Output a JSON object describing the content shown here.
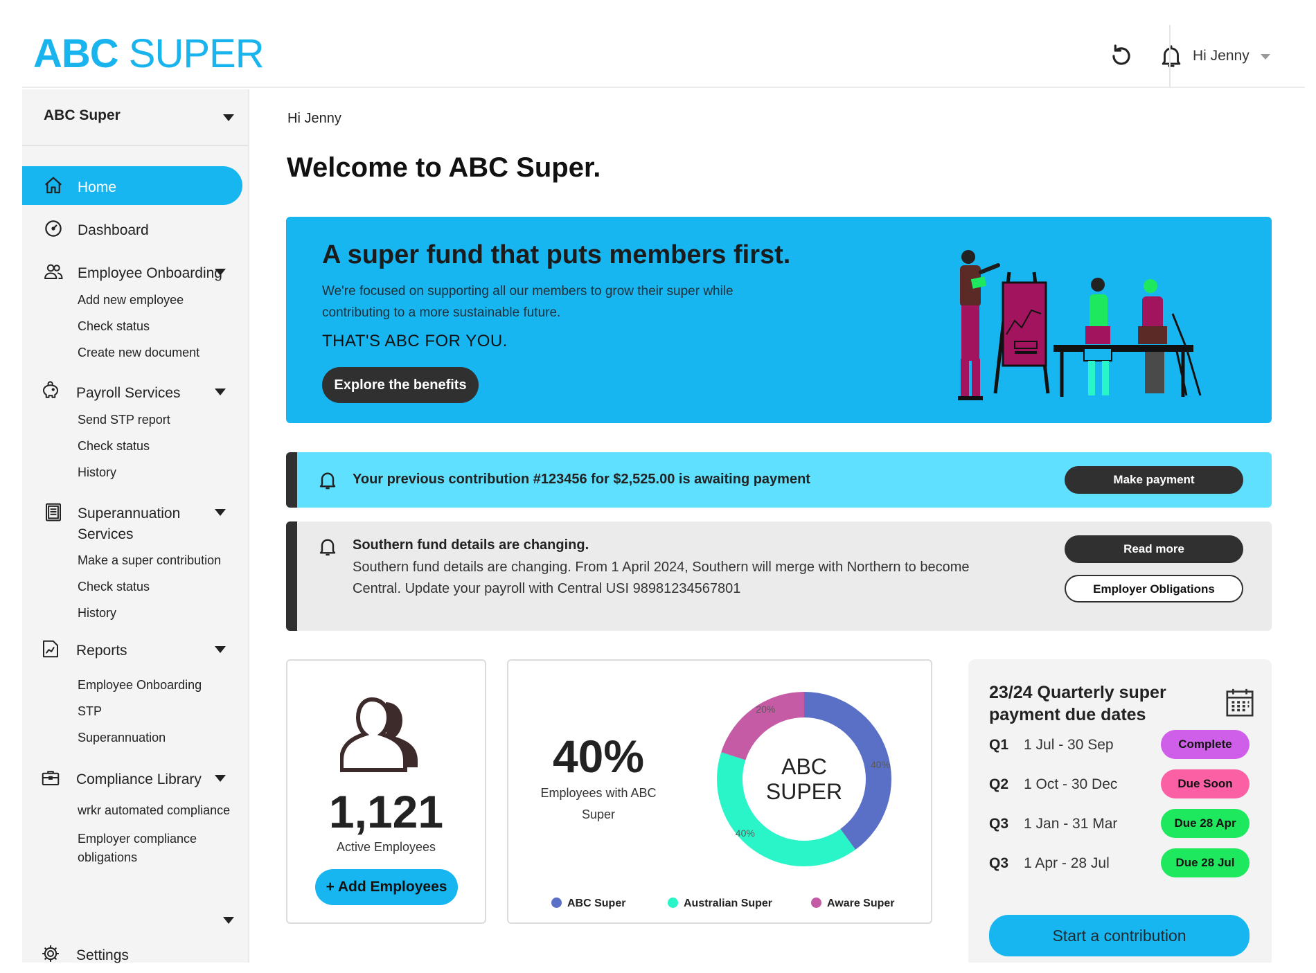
{
  "header": {
    "logo_bold": "ABC",
    "logo_light": "SUPER",
    "user_greeting": "Hi Jenny"
  },
  "sidebar": {
    "org": "ABC Super",
    "nav": [
      {
        "label": "Home",
        "icon": "home-icon"
      },
      {
        "label": "Dashboard",
        "icon": "dashboard-icon"
      },
      {
        "label": "Employee Onboarding",
        "icon": "users-icon",
        "sub": [
          "Add new employee",
          "Check status",
          "Create new document"
        ]
      },
      {
        "label": "Payroll Services",
        "icon": "piggy-bank-icon",
        "sub": [
          "Send STP report",
          "Check status",
          "History"
        ]
      },
      {
        "label": "Superannuation\nServices",
        "icon": "clipboard-icon",
        "sub": [
          "Make a super contribution",
          "Check status",
          "History"
        ]
      },
      {
        "label": "Reports",
        "icon": "report-icon",
        "sub": [
          "Employee Onboarding",
          "STP",
          "Superannuation"
        ]
      },
      {
        "label": "Compliance Library",
        "icon": "briefcase-icon",
        "sub": [
          "wrkr automated compliance",
          "Employer compliance\nobligations"
        ]
      },
      {
        "label": "Settings",
        "icon": "gear-icon"
      }
    ]
  },
  "main": {
    "greeting": "Hi Jenny",
    "welcome": "Welcome to ABC Super.",
    "hero": {
      "title": "A super fund that puts members first.",
      "body": "We're focused on supporting all our members to grow their super while contributing to a more sustainable future.",
      "tagline": "THAT'S ABC FOR YOU.",
      "button": "Explore the benefits"
    },
    "alert_payment": {
      "text": "Your previous contribution #123456 for $2,525.00 is awaiting payment",
      "button": "Make payment"
    },
    "alert_fund": {
      "title": "Southern fund details are changing.",
      "body": "Southern fund details are changing. From 1 April 2024, Southern will merge with Northern to become Central. Update your payroll with Central USI 98981234567801",
      "button_primary": "Read more",
      "button_secondary": "Employer Obligations"
    },
    "employees_card": {
      "count": "1,121",
      "caption": "Active Employees",
      "button": "+ Add Employees"
    },
    "fund_card": {
      "percent": "40%",
      "caption": "Employees with ABC Super",
      "center_label": "ABC\nSUPER"
    },
    "due_dates": {
      "title": "23/24 Quarterly super payment due dates",
      "rows": [
        {
          "q": "Q1",
          "range": "1 Jul - 30 Sep",
          "status": "Complete",
          "color": "#cf5ee9"
        },
        {
          "q": "Q2",
          "range": "1 Oct - 30 Dec",
          "status": "Due Soon",
          "color": "#fb5fa4"
        },
        {
          "q": "Q3",
          "range": "1 Jan - 31 Mar",
          "status": "Due 28 Apr",
          "color": "#1ee85d"
        },
        {
          "q": "Q3",
          "range": "1 Apr - 28 Jul",
          "status": "Due 28 Jul",
          "color": "#1ee85d"
        }
      ],
      "button": "Start a contribution"
    }
  },
  "chart_data": {
    "type": "pie",
    "title": "",
    "categories": [
      "ABC Super",
      "Australian Super",
      "Aware Super"
    ],
    "values": [
      40,
      40,
      20
    ],
    "labels": [
      "40%",
      "40%",
      "20%"
    ],
    "colors": [
      "#5a6fc6",
      "#2af5c9",
      "#c55aa5"
    ]
  },
  "colors": {
    "accent": "#18b6f1",
    "alert_blue": "#5ee0fe",
    "dark": "#303030"
  }
}
